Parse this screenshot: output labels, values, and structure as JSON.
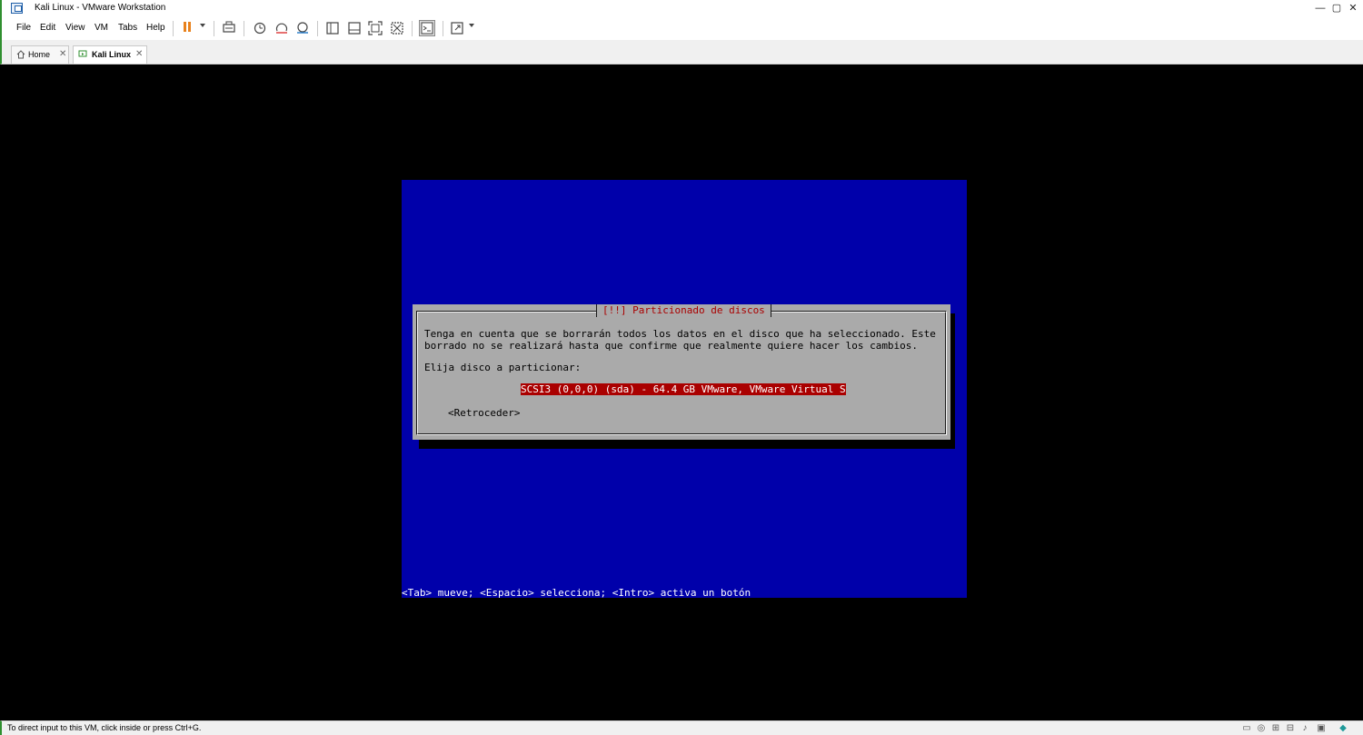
{
  "window": {
    "title": "Kali Linux - VMware Workstation",
    "minimize_glyph": "—",
    "maximize_glyph": "▢",
    "close_glyph": "✕"
  },
  "menu": {
    "items": [
      "File",
      "Edit",
      "View",
      "VM",
      "Tabs",
      "Help"
    ]
  },
  "toolbar": {
    "icons": [
      "pause-icon",
      "send-keys-icon",
      "snapshot-icon",
      "revert-snapshot-icon",
      "snapshot-manager-icon",
      "show-library-icon",
      "thumbnail-bar-icon",
      "full-screen-icon",
      "unity-icon",
      "console-view-icon",
      "stretch-guest-icon"
    ],
    "accent_color": "#e8811c"
  },
  "tabs": [
    {
      "label": "Home",
      "icon": "home-icon",
      "close_glyph": "✕",
      "active": false
    },
    {
      "label": "Kali Linux",
      "icon": "vm-icon",
      "close_glyph": "✕",
      "active": true
    }
  ],
  "installer": {
    "dialog_title": "[!!] Particionado de discos",
    "message_line1": "Tenga en cuenta que se borrarán todos los datos en el disco que ha seleccionado. Este",
    "message_line2": "borrado no se realizará hasta que confirme que realmente quiere hacer los cambios.",
    "prompt": "Elija disco a particionar:",
    "disk_option": "SCSI3 (0,0,0) (sda) - 64.4 GB VMware, VMware Virtual S",
    "back_button": "<Retroceder>",
    "hint": "<Tab> mueve; <Espacio> selecciona; <Intro> activa un botón",
    "colors": {
      "background": "#0000aa",
      "dialog": "#aaaaaa",
      "title": "#aa0000",
      "selection": "#aa0000"
    }
  },
  "statusbar": {
    "text": "To direct input to this VM, click inside or press Ctrl+G.",
    "icons": [
      "hard-disk-icon",
      "cd-dvd-icon",
      "network-icon",
      "usb-icon",
      "sound-icon",
      "display-icon",
      "message-icon"
    ]
  }
}
